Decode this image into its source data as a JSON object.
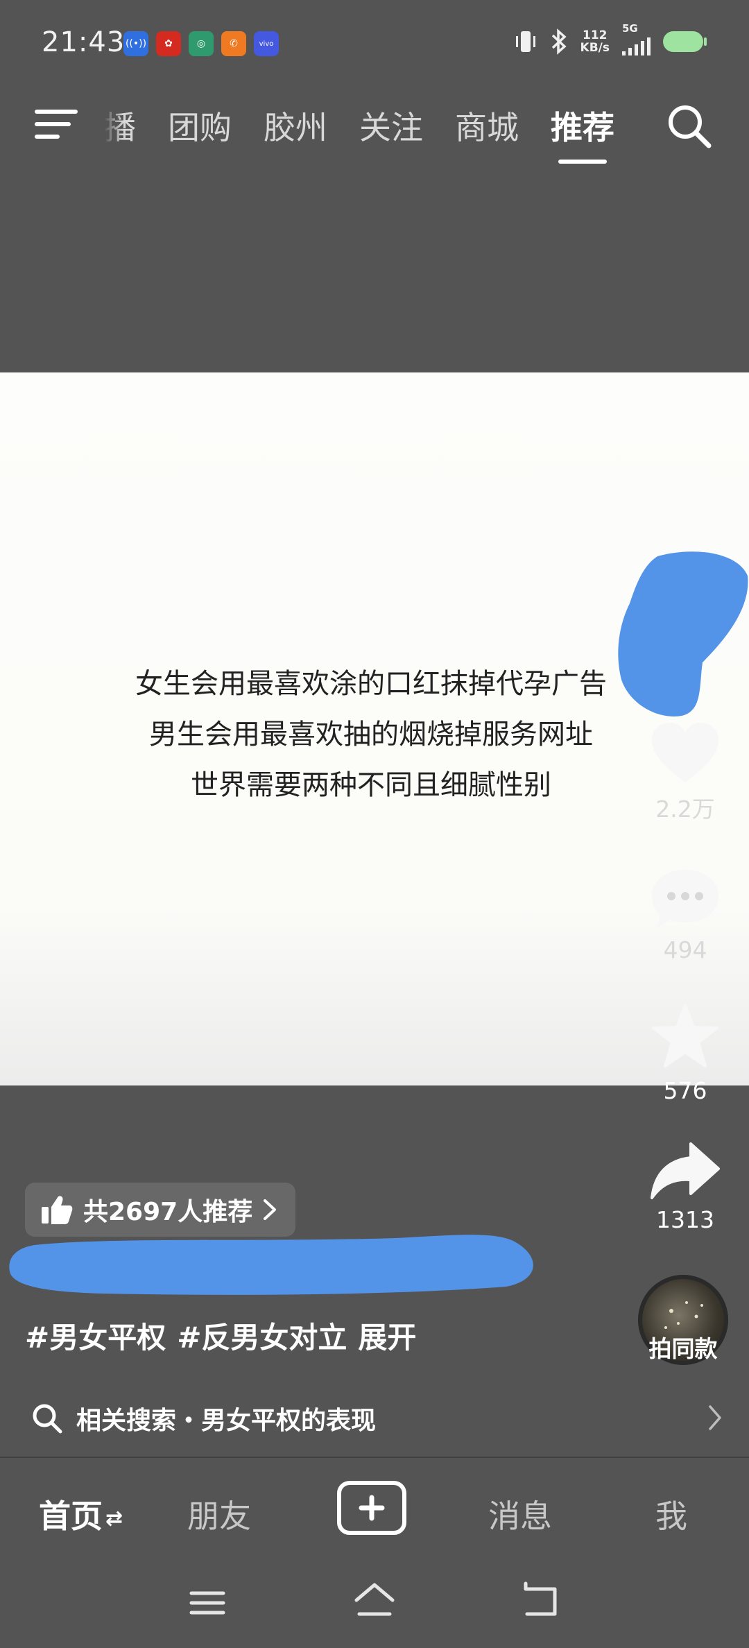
{
  "status_bar": {
    "time": "21:43",
    "net_speed_value": "112",
    "net_speed_unit": "KB/s",
    "network_type": "5G",
    "app_icons": [
      "broadcast-icon",
      "red-app-icon",
      "green-app-icon",
      "orange-phone-app-icon",
      "vivo-app-icon"
    ],
    "colors": {
      "battery": "#9fe3a1"
    }
  },
  "top_nav": {
    "tabs": [
      {
        "label": "播"
      },
      {
        "label": "团购"
      },
      {
        "label": "胶州"
      },
      {
        "label": "关注"
      },
      {
        "label": "商城"
      },
      {
        "label": "推荐"
      }
    ],
    "active_tab": "推荐"
  },
  "video": {
    "text_lines": [
      "女生会用最喜欢涂的口红抹掉代孕广告",
      "男生会用最喜欢抽的烟烧掉服务网址",
      "世界需要两种不同且细腻性别"
    ]
  },
  "actions": {
    "like_count": "2.2万",
    "comment_count": "494",
    "favorite_count": "576",
    "share_count": "1313"
  },
  "info": {
    "recommend_text": "共2697人推荐",
    "hashtags": [
      "#男女平权",
      "#反男女对立"
    ],
    "expand_label": "展开"
  },
  "related_search": {
    "text": "相关搜索・男女平权的表现"
  },
  "same_style": {
    "label": "拍同款"
  },
  "bottom_nav": {
    "home": "首页",
    "home_suffix": "⇄",
    "friends": "朋友",
    "messages": "消息",
    "me": "我"
  },
  "colors": {
    "redaction_blue": "#5394e8",
    "background": "#545454"
  }
}
